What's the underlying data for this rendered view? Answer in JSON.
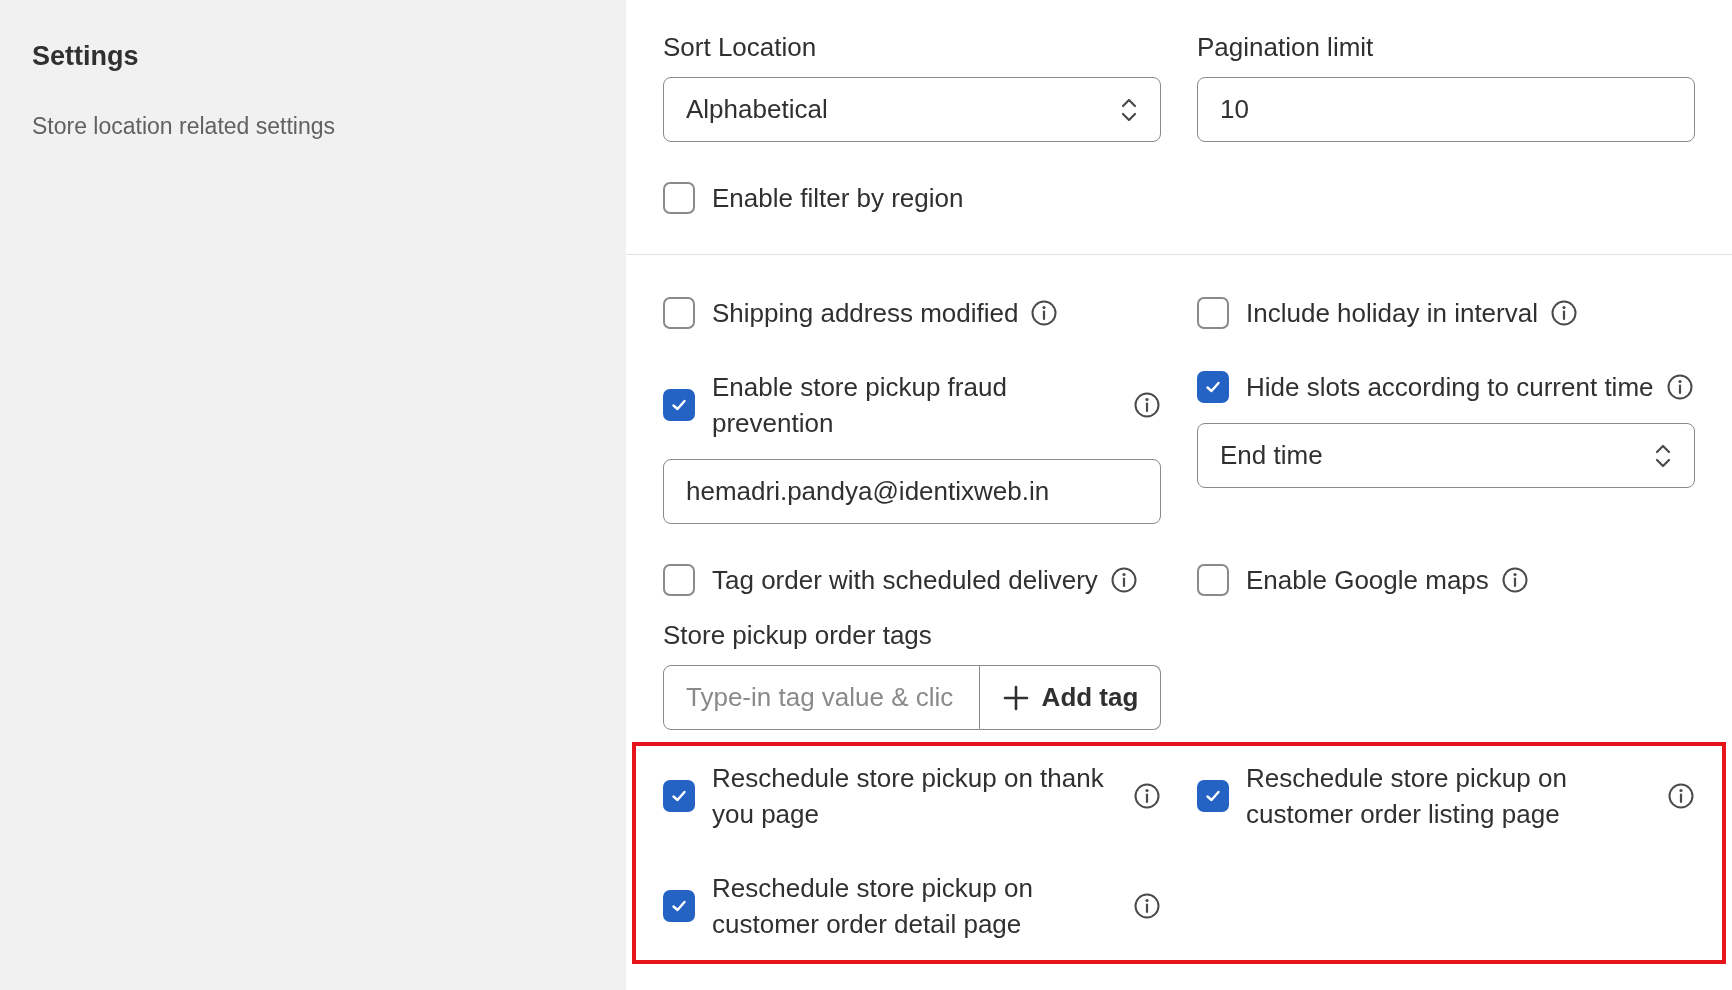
{
  "sidebar": {
    "title": "Settings",
    "description": "Store location related settings"
  },
  "sort_location": {
    "label": "Sort Location",
    "value": "Alphabetical"
  },
  "pagination_limit": {
    "label": "Pagination limit",
    "value": "10"
  },
  "filter_by_region": {
    "label": "Enable filter by region",
    "checked": false
  },
  "sections": [
    {
      "highlighted": false,
      "rows": [
        [
          [
            {
              "kind": "checkbox",
              "label": "Shipping address modified",
              "checked": false,
              "info": true
            }
          ],
          [
            {
              "kind": "checkbox",
              "label": "Include holiday in interval",
              "checked": false,
              "info": true
            }
          ]
        ],
        [
          [
            {
              "kind": "checkbox",
              "label": "Enable store pickup fraud prevention",
              "checked": true,
              "info": true
            },
            {
              "kind": "field",
              "value": "hemadri.pandya@identixweb.in"
            }
          ],
          [
            {
              "kind": "checkbox",
              "label": "Hide slots according to current time",
              "checked": true,
              "info": true
            },
            {
              "kind": "select",
              "value": "End time"
            }
          ]
        ],
        [
          [
            {
              "kind": "checkbox",
              "label": "Tag order with scheduled delivery",
              "checked": false,
              "info": true
            },
            {
              "kind": "tag_input",
              "label": "Store pickup order tags",
              "placeholder": "Type-in tag value & clic",
              "button": "Add tag"
            }
          ],
          [
            {
              "kind": "checkbox",
              "label": "Enable Google maps",
              "checked": false,
              "info": true
            }
          ]
        ]
      ]
    },
    {
      "highlighted": true,
      "rows": [
        [
          [
            {
              "kind": "checkbox",
              "label": "Reschedule store pickup on thank you page",
              "checked": true,
              "info": true
            }
          ],
          [
            {
              "kind": "checkbox",
              "label": "Reschedule store pickup on customer order listing page",
              "checked": true,
              "info": true
            }
          ]
        ],
        [
          [
            {
              "kind": "checkbox",
              "label": "Reschedule store pickup on customer order detail page",
              "checked": true,
              "info": true
            }
          ],
          []
        ]
      ]
    }
  ]
}
